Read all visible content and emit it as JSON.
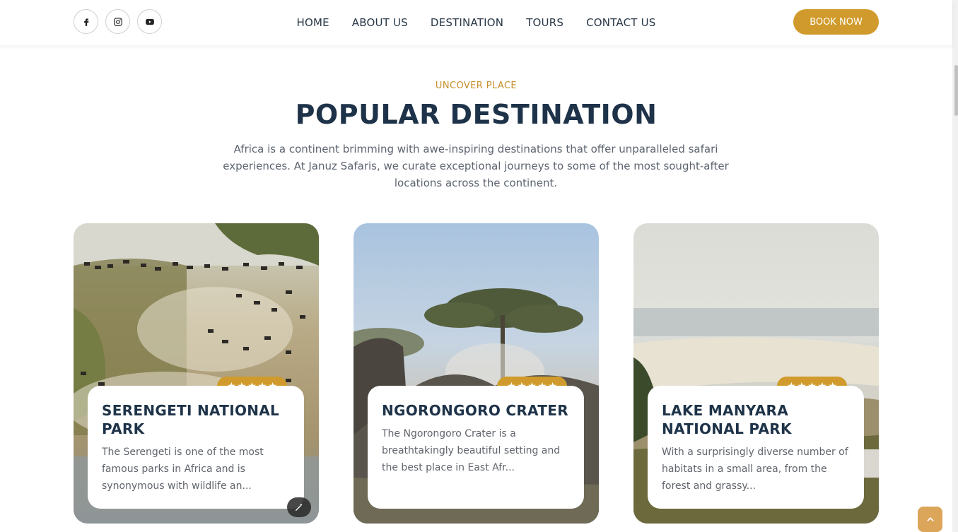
{
  "header": {
    "socials": [
      {
        "icon": "facebook-icon"
      },
      {
        "icon": "instagram-icon"
      },
      {
        "icon": "youtube-icon"
      }
    ],
    "nav": [
      "HOME",
      "ABOUT US",
      "DESTINATION",
      "TOURS",
      "CONTACT US"
    ],
    "book_label": "BOOK NOW"
  },
  "section": {
    "eyebrow": "UNCOVER PLACE",
    "title": "POPULAR DESTINATION",
    "lead": "Africa is a continent brimming with awe-inspiring destinations that offer unparalleled safari experiences. At Januz Safaris, we curate exceptional journeys to some of the most sought-after locations across the continent."
  },
  "cards": [
    {
      "title": "SERENGETI NATIONAL PARK",
      "desc": "The Serengeti is one of the most famous parks in Africa and is synonymous with wildlife an...",
      "rating": 5,
      "image": "wildebeest migration"
    },
    {
      "title": "NGORONGORO CRATER",
      "desc": "The Ngorongoro Crater is a breathtakingly beautiful setting and the best place in East Afr...",
      "rating": 5,
      "image": "elephants under acacia"
    },
    {
      "title": "LAKE MANYARA NATIONAL PARK",
      "desc": "With a surprisingly diverse number of habitats in a small area, from the forest and grassy...",
      "rating": 5,
      "image": "lake view"
    }
  ],
  "colors": {
    "accent": "#d09b2c",
    "heading": "#1e3349",
    "body_text": "#5d6470"
  }
}
